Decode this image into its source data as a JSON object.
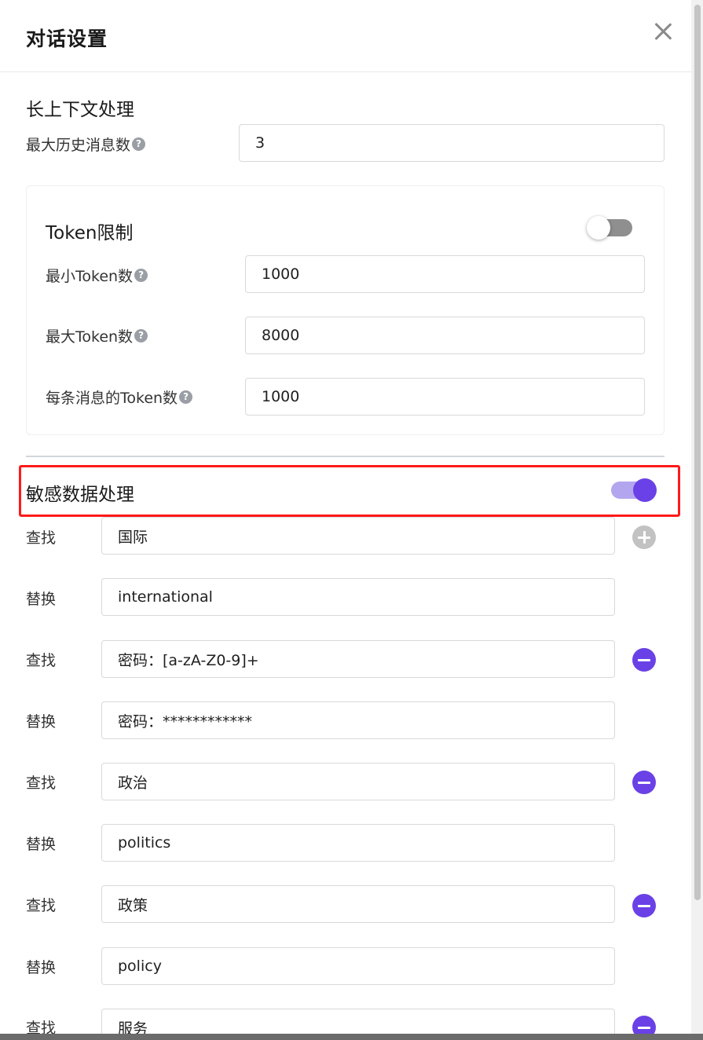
{
  "dialog": {
    "title": "对话设置"
  },
  "long_context": {
    "heading": "长上下文处理",
    "max_history": {
      "label": "最大历史消息数",
      "value": "3"
    }
  },
  "token_limit": {
    "heading": "Token限制",
    "enabled": false,
    "min_tokens": {
      "label": "最小Token数",
      "value": "1000"
    },
    "max_tokens": {
      "label": "最大Token数",
      "value": "8000"
    },
    "per_message": {
      "label": "每条消息的Token数",
      "value": "1000"
    }
  },
  "sensitive": {
    "heading": "敏感数据处理",
    "enabled": true,
    "find_label": "查找",
    "replace_label": "替换",
    "rules": [
      {
        "find": "国际",
        "replace": "international"
      },
      {
        "find": "密码：[a-zA-Z0-9]+",
        "replace": "密码：************"
      },
      {
        "find": "政治",
        "replace": "politics"
      },
      {
        "find": "政策",
        "replace": "policy"
      },
      {
        "find": "服务",
        "replace": ""
      }
    ]
  },
  "colors": {
    "accent": "#6a41e6",
    "highlight_border": "#ff1a1a"
  },
  "icons": {
    "close": "close-icon",
    "help": "question-circle-icon",
    "add": "plus-circle-icon",
    "remove": "minus-circle-icon"
  }
}
